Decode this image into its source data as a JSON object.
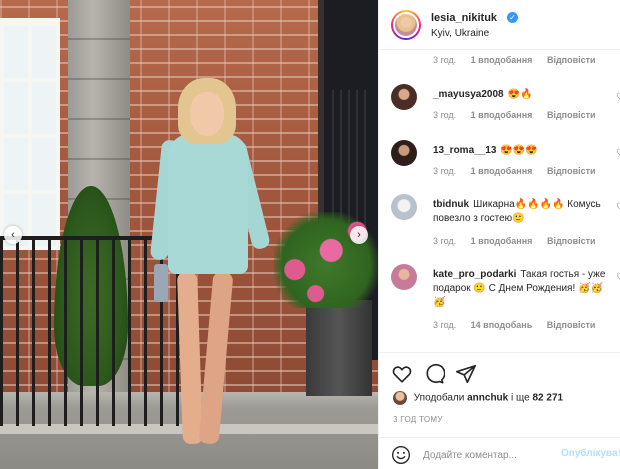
{
  "post": {
    "username": "lesia_nikituk",
    "location": "Kyiv, Ukraine"
  },
  "comments": [
    {
      "user": "",
      "text": "",
      "time": "3 год.",
      "likes": "1 вподобання",
      "reply": "Відповісти"
    },
    {
      "user": "_mayusya2008",
      "text": "😍🔥",
      "time": "3 год.",
      "likes": "1 вподобання",
      "reply": "Відповісти"
    },
    {
      "user": "13_roma__13",
      "text": "😍😍😍",
      "time": "3 год.",
      "likes": "1 вподобання",
      "reply": "Відповісти"
    },
    {
      "user": "tbidnuk",
      "text": "Шикарна🔥🔥🔥🔥 Комусь повезло з гостею🙂",
      "time": "3 год.",
      "likes": "1 вподобання",
      "reply": "Відповісти"
    },
    {
      "user": "kate_pro_podarki",
      "text": "Такая гостья - уже подарок 🙂 С Днем Рождения! 🥳🥳🥳",
      "time": "3 год.",
      "likes": "14 вподобань",
      "reply": "Відповісти"
    }
  ],
  "likes": {
    "prefix": "Уподобали",
    "user": "annchuk",
    "suffix": "і ще",
    "count": "82 271"
  },
  "timestamp": "3 ГОД ТОМУ",
  "add_comment": {
    "placeholder": "Додайте коментар...",
    "publish_label": "Опублікувати"
  },
  "icons": {
    "like": "heart-outline-icon",
    "comment": "speech-bubble-icon",
    "share": "paper-plane-icon",
    "emoji": "smiley-icon",
    "verified": "verified-badge-icon"
  },
  "colors": {
    "verified": "#3897f0",
    "muted": "#8e8e8e",
    "text": "#262626",
    "publish_disabled": "#b2dffc"
  }
}
